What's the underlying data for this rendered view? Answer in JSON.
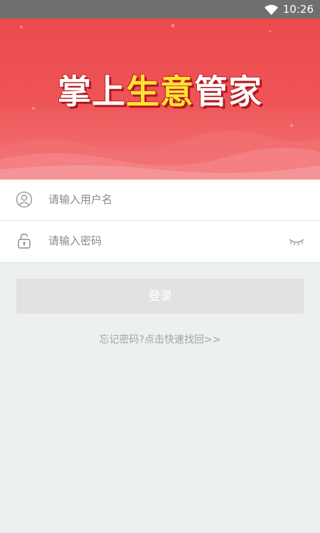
{
  "status_bar": {
    "time": "10:26",
    "icons": [
      "wifi-icon"
    ]
  },
  "banner": {
    "title_part1": "掌上",
    "title_highlight": "生意",
    "title_part2": "管家",
    "colors": {
      "background": "#ee5456",
      "title": "#ffffff",
      "highlight": "#ffe433"
    }
  },
  "login_form": {
    "username": {
      "icon": "user-icon",
      "value": "",
      "placeholder": "请输入用户名"
    },
    "password": {
      "icon": "lock-icon",
      "value": "",
      "placeholder": "请输入密码",
      "toggle_icon": "eye-closed-icon"
    }
  },
  "actions": {
    "login_label": "登录",
    "forgot_label": "忘记密码?点击快速找回>>"
  }
}
